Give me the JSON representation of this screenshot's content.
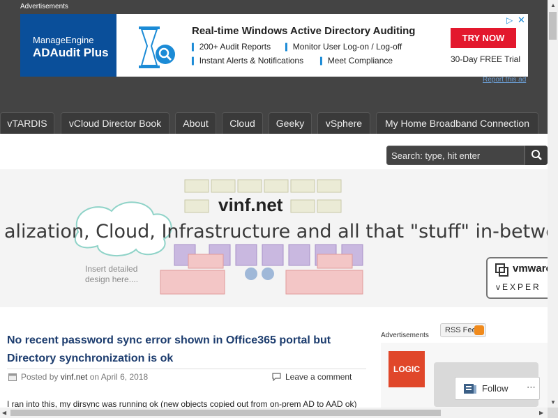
{
  "top_ads": {
    "label": "Advertisements",
    "report": "Report this ad"
  },
  "banner_ad": {
    "brand_top": "ManageEngine",
    "brand_bottom": "ADAudit Plus",
    "headline": "Real-time Windows Active Directory Auditing",
    "bullets": [
      "200+ Audit Reports",
      "Monitor User Log-on / Log-off",
      "Instant Alerts & Notifications",
      "Meet Compliance"
    ],
    "cta": "TRY NOW",
    "trial": "30-Day FREE Trial",
    "choices_icon": "adchoices-icon",
    "close_icon": "close-icon"
  },
  "nav": {
    "tabs": [
      "vTARDIS",
      "vCloud Director Book",
      "About",
      "Cloud",
      "Geeky",
      "vSphere",
      "My Home Broadband Connection"
    ]
  },
  "search": {
    "placeholder": "Search: type, hit enter",
    "icon": "search-icon"
  },
  "header": {
    "site_title": "vinf.net",
    "tagline": "alization, Cloud, Infrastructure and all that \"stuff\" in-betwee",
    "insert_note_line1": "Insert detailed",
    "insert_note_line2": "design here....",
    "badge_logo": "vmware",
    "badge_sub": "vEXPER"
  },
  "post": {
    "title": "No recent password sync error shown in Office365 portal but Directory synchronization is ok",
    "posted_by": "Posted by ",
    "author": "vinf.net",
    "on": " on April 6, 2018",
    "comment": "Leave a comment",
    "excerpt": "I ran into this, my dirsync was running ok (new objects copied out from on-prem AD to AAD ok)"
  },
  "sidebar": {
    "ads_label": "Advertisements",
    "rss": "RSS Feed",
    "logo_text": "LOGIC",
    "follow": "Follow"
  },
  "colors": {
    "dark_band": "#444444",
    "title_blue": "#1c3c6e",
    "cta_red": "#e3182d",
    "brand_blue": "#0a4f9a"
  }
}
